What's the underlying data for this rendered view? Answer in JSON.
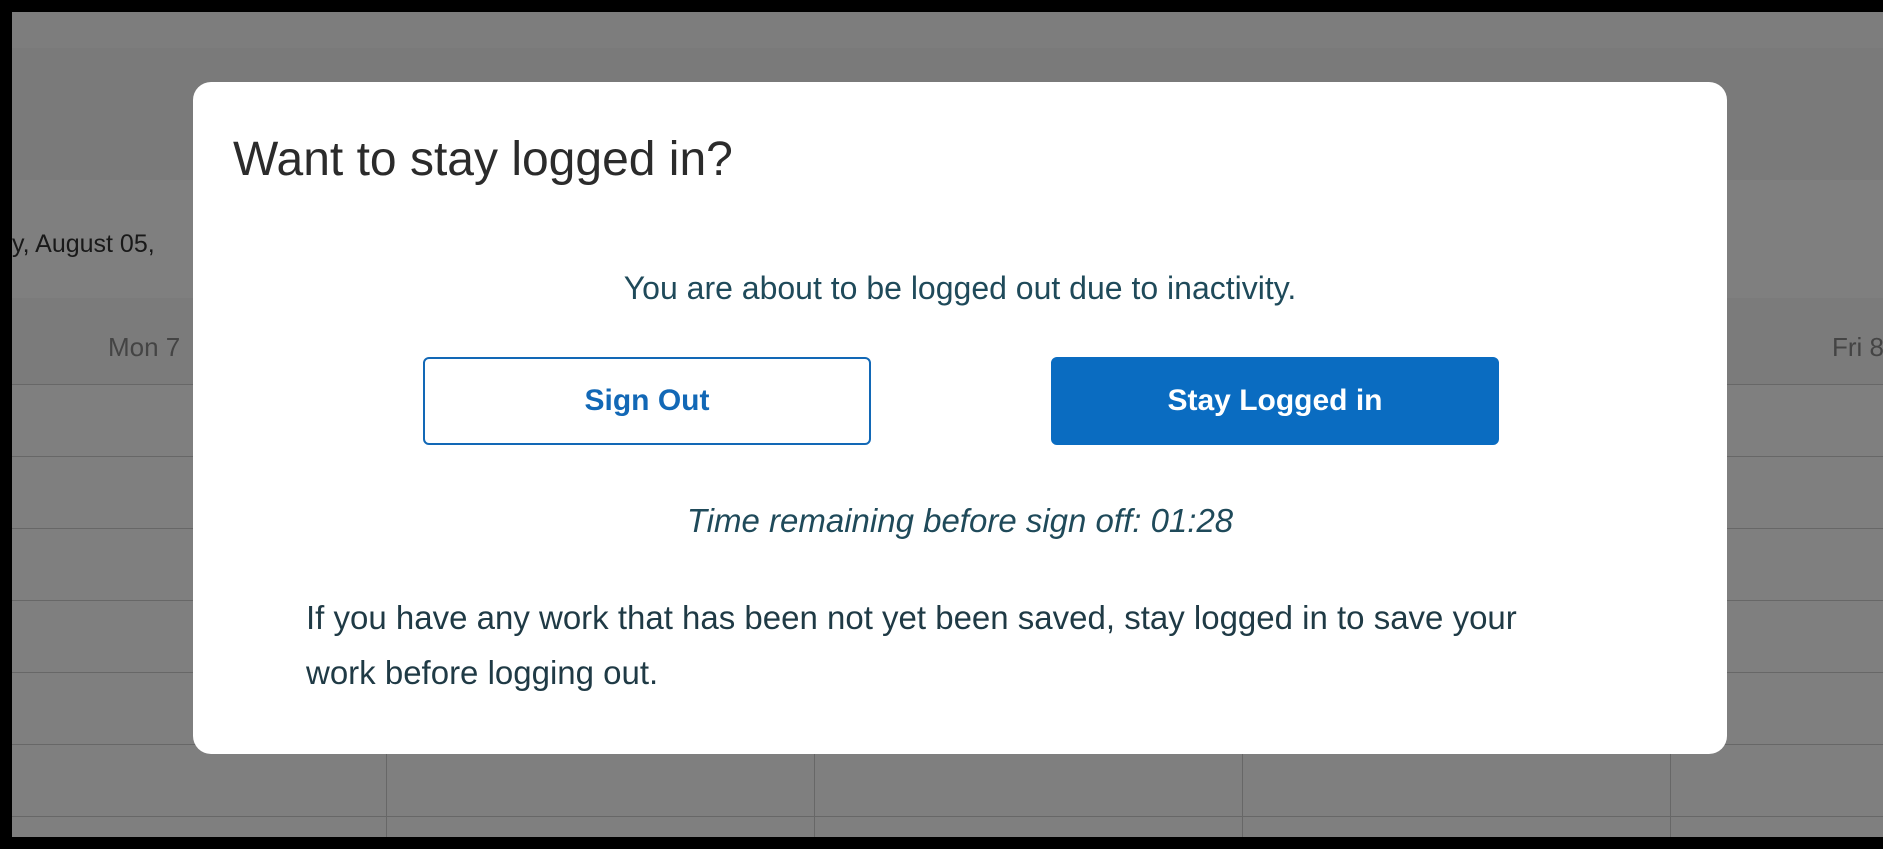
{
  "background": {
    "date_label": "y, August 05,",
    "day_headers": [
      "Mon 7",
      "Fri 8"
    ]
  },
  "dialog": {
    "title": "Want to stay logged in?",
    "message": "You are about to be logged out due to inactivity.",
    "sign_out_label": "Sign Out",
    "stay_label": "Stay Logged in",
    "timer_prefix": "Time remaining before sign off: ",
    "timer_value": "01:28",
    "note": "If you have any work that has been not yet been saved, stay logged in to save your work before logging out."
  },
  "colors": {
    "primary": "#0a6cc1",
    "text_dark": "#2b2b2b",
    "text_teal": "#1f4a5a",
    "overlay": "rgba(0,0,0,0.5)"
  }
}
